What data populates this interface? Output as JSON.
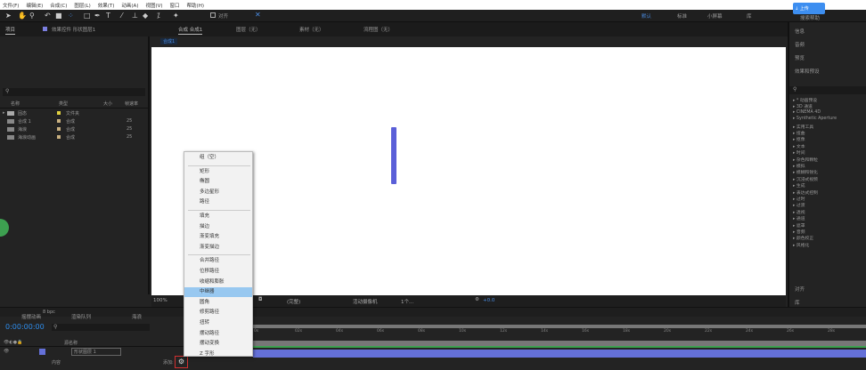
{
  "menu": [
    "文件(F)",
    "编辑(E)",
    "合成(C)",
    "图层(L)",
    "效果(T)",
    "动画(A)",
    "视图(V)",
    "窗口",
    "帮助(H)"
  ],
  "toolbar": {
    "snap_label": "对齐",
    "workspaces": [
      "默认",
      "标准",
      "小屏幕",
      "库"
    ],
    "search_help": "搜索帮助",
    "cloud_badge": "↓ 上传"
  },
  "panels": {
    "project": "项目",
    "effect_controls": "效果控件 形状图层1",
    "composition": "合成 合成1",
    "layer": "图层（无）",
    "footage": "素材（无）",
    "flowchart": "流程图（无）",
    "comp_tab": "合成1"
  },
  "project": {
    "search_placeholder": "",
    "columns": [
      "名称",
      "类型",
      "大小",
      "帧速率"
    ],
    "items": [
      {
        "name": "固态",
        "type": "文件夹",
        "fps": "",
        "color": "#e0d040"
      },
      {
        "name": "合成 1",
        "type": "合成",
        "fps": "25",
        "color": "#c8b080"
      },
      {
        "name": "海浪",
        "type": "合成",
        "fps": "25",
        "color": "#c8b080"
      },
      {
        "name": "海浪动画",
        "type": "合成",
        "fps": "25",
        "color": "#c8b080"
      }
    ]
  },
  "right_panel": {
    "sections": [
      "信息",
      "音频",
      "预览",
      "效果和预设"
    ],
    "effects": [
      "* 动画预设",
      "3D 通道",
      "CINEMA 4D",
      "Synthetic Aperture",
      "实用工具",
      "扭曲",
      "抠像",
      "文本",
      "时间",
      "杂色和颗粒",
      "模拟",
      "模糊和锐化",
      "沉浸式视频",
      "生成",
      "表达式控制",
      "过时",
      "过渡",
      "透视",
      "通道",
      "遮罩",
      "音频",
      "颜色校正",
      "风格化"
    ],
    "bottom": [
      "对齐",
      "库"
    ]
  },
  "viewer_toolbar": {
    "zoom": "100%",
    "resolution": "(完整)",
    "camera": "活动摄像机",
    "views": "1个...",
    "exposure": "+0.0"
  },
  "context_menu": {
    "groups": [
      [
        "组（空）"
      ],
      [
        "矩形",
        "椭圆",
        "多边星形",
        "路径"
      ],
      [
        "填充",
        "描边",
        "渐变填充",
        "渐变描边"
      ],
      [
        "合并路径",
        "位移路径",
        "收缩和膨胀",
        "中继器",
        "圆角",
        "修剪路径",
        "扭转",
        "摆动路径",
        "摆动变换",
        "Z 字形"
      ]
    ],
    "highlighted": "中继器"
  },
  "timeline": {
    "tabs": [
      "摇摆动画",
      "渲染队列",
      "海浪",
      "合成1"
    ],
    "timecode": "0:00:00:00",
    "bpc": "8 bpc",
    "layer_header": "源名称",
    "layer_name": "形状图层 1",
    "content_label": "内容",
    "add_label": "添加:",
    "ruler": [
      "0s",
      "02s",
      "04s",
      "06s",
      "08s",
      "10s",
      "12s",
      "14s",
      "16s",
      "18s",
      "20s",
      "22s",
      "24s",
      "26s",
      "28s"
    ]
  },
  "colors": {
    "accent": "#2d8ceb",
    "shape": "#5a5fd8",
    "layer_bar": "#6470d8",
    "highlight": "#98c8f0",
    "green": "#3da050"
  }
}
